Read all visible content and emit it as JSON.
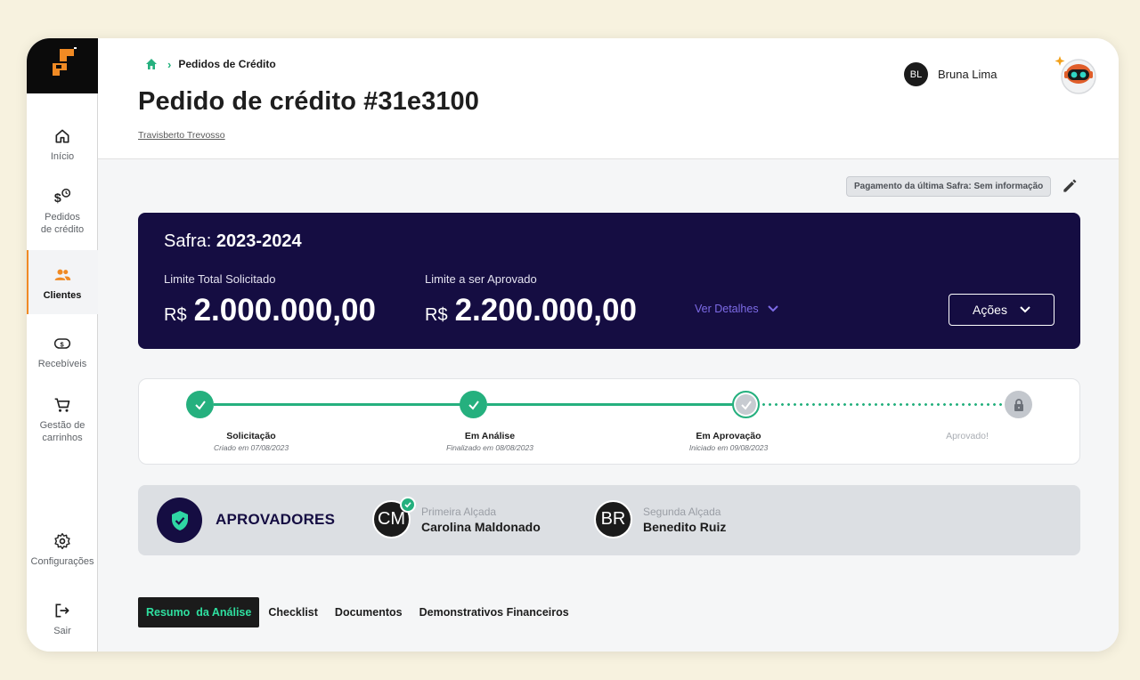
{
  "breadcrumb": {
    "current": "Pedidos de Crédito"
  },
  "page": {
    "title": "Pedido de crédito #31e3100",
    "client": "Travisberto Trevosso"
  },
  "user": {
    "initials": "BL",
    "name": "Bruna Lima"
  },
  "sidebar": {
    "items": [
      {
        "label": "Início",
        "icon": "home-icon"
      },
      {
        "label": "Pedidos de crédito",
        "icon": "money-clock-icon"
      },
      {
        "label": "Clientes",
        "icon": "users-icon",
        "active": true
      },
      {
        "label": "Recebíveis",
        "icon": "banknote-icon"
      },
      {
        "label": "Gestão de carrinhos",
        "icon": "cart-icon"
      },
      {
        "label": "Configurações",
        "icon": "gear-icon"
      },
      {
        "label": "Sair",
        "icon": "logout-icon"
      }
    ]
  },
  "payment_tag": "Pagamento da última Safra: Sem informação",
  "safra": {
    "label": "Safra: ",
    "value": "2023-2024",
    "limit_requested_label": "Limite Total Solicitado",
    "limit_requested_currency": "R$",
    "limit_requested_value": "2.000.000,00",
    "limit_approved_label": "Limite a ser Aprovado",
    "limit_approved_currency": "R$",
    "limit_approved_value": "2.200.000,00",
    "details_link": "Ver Detalhes",
    "actions_button": "Ações"
  },
  "steps": [
    {
      "name": "Solicitação",
      "date": "Criado em 07/08/2023",
      "status": "done"
    },
    {
      "name": "Em Análise",
      "date": "Finalizado em 08/08/2023",
      "status": "done"
    },
    {
      "name": "Em Aprovação",
      "date": "Iniciado em 09/08/2023",
      "status": "current"
    },
    {
      "name": "Aprovado!",
      "date": "",
      "status": "locked"
    }
  ],
  "approvers": {
    "title": "APROVADORES",
    "people": [
      {
        "initials": "CM",
        "role": "Primeira Alçada",
        "name": "Carolina Maldonado",
        "approved": true
      },
      {
        "initials": "BR",
        "role": "Segunda Alçada",
        "name": "Benedito Ruiz",
        "approved": false
      }
    ]
  },
  "tabs": [
    "Resumo  da Análise",
    "Checklist",
    "Documentos",
    "Demonstrativos Financeiros"
  ],
  "colors": {
    "accent": "#25b07e",
    "navy": "#150d42",
    "brand_orange": "#f08a24",
    "link_purple": "#7d6be6"
  }
}
